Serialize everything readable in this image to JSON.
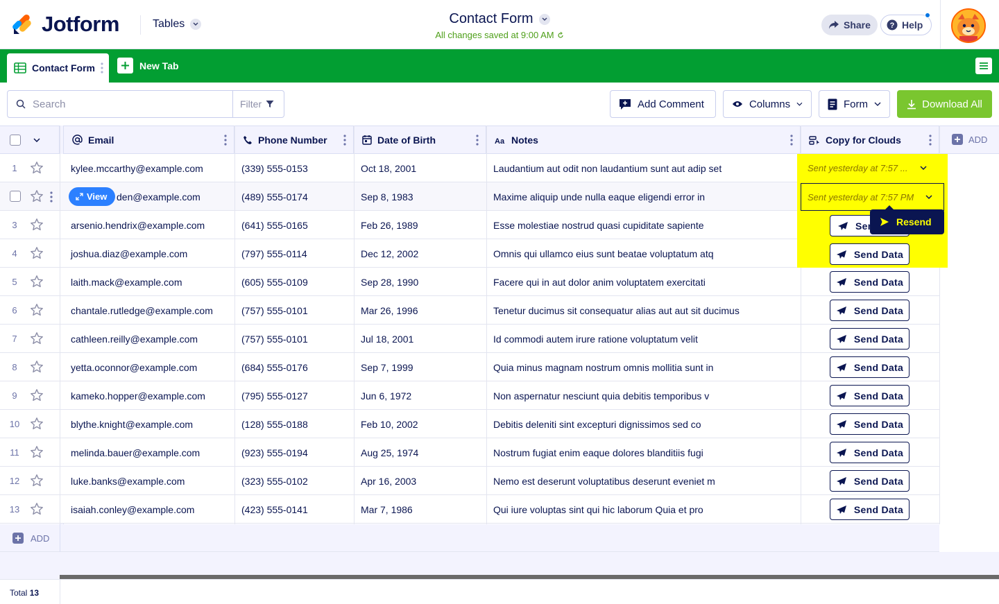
{
  "header": {
    "brand": "Jotform",
    "tables_menu": "Tables",
    "title": "Contact Form",
    "saved_status": "All changes saved at 9:00 AM",
    "share_label": "Share",
    "help_label": "Help"
  },
  "tabs": {
    "active_label": "Contact Form",
    "new_tab_label": "New Tab"
  },
  "toolbar": {
    "search_placeholder": "Search",
    "filter_label": "Filter",
    "add_comment_label": "Add Comment",
    "columns_label": "Columns",
    "form_label": "Form",
    "download_label": "Download All"
  },
  "columns": {
    "email": "Email",
    "phone": "Phone Number",
    "dob": "Date of Birth",
    "notes": "Notes",
    "clouds": "Copy for Clouds",
    "add": "ADD"
  },
  "rows": [
    {
      "num": "1",
      "email": "kylee.mccarthy@example.com",
      "phone": "(339) 555-0153",
      "dob": "Oct 18, 2001",
      "notes": "Laudantium aut odit non laudantium sunt aut adip set",
      "status": "Sent yesterday at 7:57 ..."
    },
    {
      "num": "2",
      "email": "den@example.com",
      "phone": "(489) 555-0174",
      "dob": "Sep 8, 1983",
      "notes": "Maxime aliquip unde nulla eaque eligendi error in",
      "status": "Sent yesterday at 7:57 PM"
    },
    {
      "num": "3",
      "email": "arsenio.hendrix@example.com",
      "phone": "(641) 555-0165",
      "dob": "Feb 26, 1989",
      "notes": "Esse molestiae nostrud quasi cupiditate sapiente",
      "status": "Sen"
    },
    {
      "num": "4",
      "email": "joshua.diaz@example.com",
      "phone": "(797) 555-0114",
      "dob": "Dec 12, 2002",
      "notes": "Omnis qui ullamco eius sunt beatae voluptatum atq",
      "status": "Send Data"
    },
    {
      "num": "5",
      "email": "laith.mack@example.com",
      "phone": "(605) 555-0109",
      "dob": "Sep 28, 1990",
      "notes": "Facere qui in aut dolor anim voluptatem exercitati",
      "status": "Send Data"
    },
    {
      "num": "6",
      "email": "chantale.rutledge@example.com",
      "phone": "(757) 555-0101",
      "dob": "Mar 26, 1996",
      "notes": "Tenetur ducimus sit consequatur alias aut aut sit ducimus",
      "status": "Send Data"
    },
    {
      "num": "7",
      "email": "cathleen.reilly@example.com",
      "phone": "(757) 555-0101",
      "dob": "Jul 18, 2001",
      "notes": "Id commodi autem irure ratione voluptatum velit",
      "status": "Send Data"
    },
    {
      "num": "8",
      "email": "yetta.oconnor@example.com",
      "phone": "(684) 555-0176",
      "dob": "Sep 7, 1999",
      "notes": "Quia minus magnam nostrum omnis mollitia sunt in",
      "status": "Send Data"
    },
    {
      "num": "9",
      "email": "kameko.hopper@example.com",
      "phone": "(795) 555-0127",
      "dob": "Jun 6, 1972",
      "notes": "Non aspernatur nesciunt quia debitis temporibus v",
      "status": "Send Data"
    },
    {
      "num": "10",
      "email": "blythe.knight@example.com",
      "phone": "(128) 555-0188",
      "dob": "Feb 10, 2002",
      "notes": "Debitis deleniti sint excepturi dignissimos sed co",
      "status": "Send Data"
    },
    {
      "num": "11",
      "email": "melinda.bauer@example.com",
      "phone": "(923) 555-0194",
      "dob": "Aug 25, 1974",
      "notes": "Nostrum fugiat enim eaque dolores blanditiis fugi",
      "status": "Send Data"
    },
    {
      "num": "12",
      "email": "luke.banks@example.com",
      "phone": "(323) 555-0102",
      "dob": "Apr 16, 2003",
      "notes": "Nemo est deserunt voluptatibus deserunt eveniet m",
      "status": "Send Data"
    },
    {
      "num": "13",
      "email": "isaiah.conley@example.com",
      "phone": "(423) 555-0141",
      "dob": "Mar 7, 1986",
      "notes": "Qui iure voluptas sint qui hic laborum Quia et pro",
      "status": "Send Data"
    }
  ],
  "overlay": {
    "view_label": "View",
    "resend_label": "Resend"
  },
  "add_row_label": "ADD",
  "footer": {
    "total_label": "Total",
    "total_count": "13"
  },
  "colors": {
    "brand_green": "#029e32",
    "download_green": "#7ac62f",
    "navy": "#0a1551",
    "highlight_yellow": "#ffff00",
    "view_blue": "#2c80ff"
  }
}
